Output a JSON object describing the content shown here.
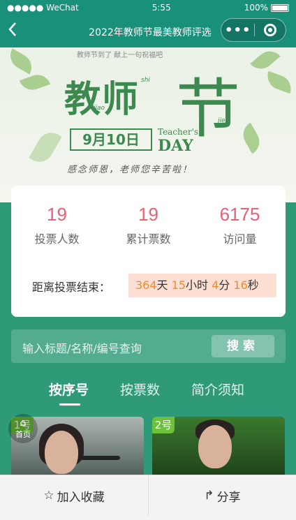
{
  "status": {
    "carrier": "●●●●● WeChat",
    "time": "5:55",
    "battery": "100%"
  },
  "nav": {
    "title": "2022年教师节最美教师评选"
  },
  "banner": {
    "top_text": "教师节到了 献上一句祝福吧",
    "title_main": "教师",
    "title_jie": "节",
    "pinyin_jiao": "jiao",
    "pinyin_shi": "shi",
    "pinyin_jie": "jie",
    "date": "9月10日",
    "teachers": "Teacher's",
    "day": "DAY",
    "slogan": "感念师恩，老师您辛苦啦！"
  },
  "stats": [
    {
      "value": "19",
      "label": "投票人数"
    },
    {
      "value": "19",
      "label": "累计票数"
    },
    {
      "value": "6175",
      "label": "访问量"
    }
  ],
  "countdown": {
    "label": "距离投票结束：",
    "days": "364",
    "days_unit": "天",
    "hours": "15",
    "hours_unit": "小时",
    "minutes": "4",
    "minutes_unit": "分",
    "seconds": "16",
    "seconds_unit": "秒"
  },
  "search": {
    "placeholder": "输入标题/名称/编号查询",
    "button": "搜索"
  },
  "tabs": [
    {
      "label": "按序号",
      "active": true
    },
    {
      "label": "按票数",
      "active": false
    },
    {
      "label": "简介须知",
      "active": false
    }
  ],
  "entries": [
    {
      "badge": "1号"
    },
    {
      "badge": "2号"
    }
  ],
  "home": {
    "label": "首页"
  },
  "bottom": {
    "favorite": "加入收藏",
    "share": "分享"
  }
}
